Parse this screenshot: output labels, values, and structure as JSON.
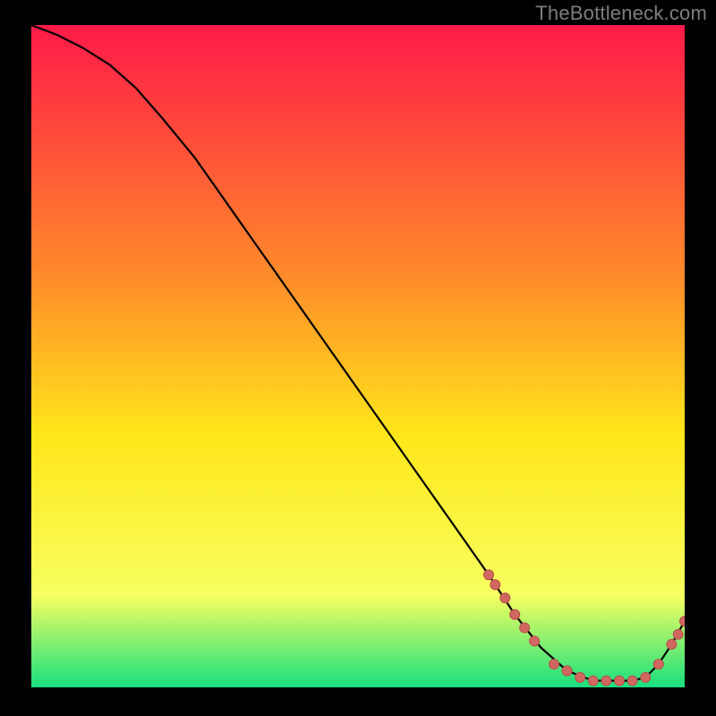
{
  "watermark": "TheBottleneck.com",
  "colors": {
    "frame": "#000000",
    "watermark_text": "#7d7d7d",
    "gradient_top": "#ff1a48",
    "gradient_mid1": "#ff8b2a",
    "gradient_mid2": "#ffe71a",
    "gradient_mid3": "#f8ff60",
    "gradient_bottom": "#18e07e",
    "curve": "#000000",
    "marker_fill": "#d06860",
    "marker_stroke": "#b94f4c"
  },
  "chart_data": {
    "type": "line",
    "title": "",
    "xlabel": "",
    "ylabel": "",
    "xlim": [
      0,
      100
    ],
    "ylim": [
      0,
      100
    ],
    "x": [
      0,
      4,
      8,
      12,
      16,
      20,
      25,
      30,
      35,
      40,
      45,
      50,
      55,
      60,
      65,
      70,
      74,
      78,
      82,
      86,
      88,
      90,
      92,
      94,
      96,
      98,
      100
    ],
    "y": [
      100,
      98.5,
      96.5,
      94,
      90.5,
      86,
      80,
      73,
      66,
      59,
      52,
      45,
      38,
      31,
      24,
      17,
      11,
      6,
      2.5,
      1,
      1,
      1,
      1,
      1.5,
      3.5,
      6.5,
      10
    ],
    "markers": {
      "x": [
        70,
        71,
        72.5,
        74,
        75.5,
        77,
        80,
        82,
        84,
        86,
        88,
        90,
        92,
        94,
        96,
        98,
        99,
        100
      ],
      "y": [
        17,
        15.5,
        13.5,
        11,
        9,
        7,
        3.5,
        2.5,
        1.5,
        1,
        1,
        1,
        1,
        1.5,
        3.5,
        6.5,
        8,
        10
      ]
    }
  }
}
